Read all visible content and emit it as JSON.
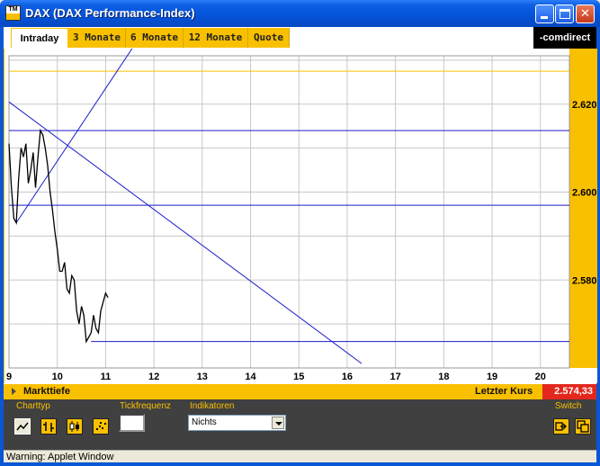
{
  "window": {
    "title": "DAX (DAX Performance-Index)",
    "icon_label": "TM",
    "minimize_glyph": "",
    "close_glyph": "✕"
  },
  "tabs": [
    {
      "label": "Intraday",
      "active": true
    },
    {
      "label": "3 Monate",
      "active": false
    },
    {
      "label": "6 Monate",
      "active": false
    },
    {
      "label": "12 Monate",
      "active": false
    },
    {
      "label": "Quote",
      "active": false
    }
  ],
  "brand": "-comdirect",
  "chart_data": {
    "type": "line",
    "x_ticks": [
      "9",
      "10",
      "11",
      "12",
      "13",
      "14",
      "15",
      "16",
      "17",
      "18",
      "19",
      "20"
    ],
    "y_ticks": [
      "2.620",
      "2.600",
      "2.580"
    ],
    "y_tick_values": [
      2620,
      2600,
      2580
    ],
    "x_range": [
      9,
      20.6
    ],
    "y_range": [
      2560,
      2631
    ],
    "grid": true,
    "series": [
      {
        "color": "#000000",
        "x": [
          9.0,
          9.05,
          9.1,
          9.15,
          9.2,
          9.25,
          9.3,
          9.35,
          9.4,
          9.45,
          9.5,
          9.55,
          9.6,
          9.65,
          9.7,
          9.75,
          9.8,
          9.85,
          9.9,
          9.95,
          10.0,
          10.05,
          10.1,
          10.15,
          10.2,
          10.25,
          10.3,
          10.35,
          10.4,
          10.45,
          10.5,
          10.55,
          10.6,
          10.65,
          10.7,
          10.75,
          10.8,
          10.85,
          10.9,
          10.95,
          11.0,
          11.05
        ],
        "y": [
          2611,
          2601,
          2594,
          2593,
          2603,
          2610,
          2608,
          2611,
          2602,
          2605,
          2609,
          2601,
          2608,
          2614,
          2613,
          2610,
          2606,
          2600,
          2596,
          2591,
          2587,
          2582,
          2582,
          2584,
          2578,
          2577,
          2581,
          2580,
          2573,
          2570,
          2574,
          2572,
          2566,
          2567,
          2568,
          2572,
          2569,
          2568,
          2573,
          2575,
          2577,
          2576
        ]
      }
    ],
    "reference_lines": [
      {
        "kind": "horizontal",
        "y": 2627.5,
        "color": "#f9c000"
      },
      {
        "kind": "horizontal",
        "y": 2614,
        "color": "#1c1ccc"
      },
      {
        "kind": "horizontal",
        "y": 2597,
        "color": "#1c1ccc"
      },
      {
        "kind": "horizontal",
        "y": 2566,
        "color": "#1c1ccc",
        "x_start": 10.7
      },
      {
        "kind": "trend",
        "from": [
          9.0,
          2620.5
        ],
        "to": [
          16.3,
          2561
        ],
        "color": "#1c1ccc"
      },
      {
        "kind": "trend",
        "from": [
          9.15,
          2593
        ],
        "to": [
          11.6,
          2633.5
        ],
        "color": "#1c1ccc"
      }
    ]
  },
  "infobar": {
    "left_label": "Markttiefe",
    "last_price_label": "Letzter Kurs",
    "last_price_value": "2.574,33"
  },
  "controls": {
    "charttyp_label": "Charttyp",
    "tickfrequenz_label": "Tickfrequenz",
    "indikatoren_label": "Indikatoren",
    "indikatoren_value": "Nichts",
    "switch_label": "Switch"
  },
  "status_text": "Warning: Applet Window",
  "colors": {
    "accent": "#f9c000",
    "title_blue": "#0452d8",
    "price_red": "#e3271c",
    "panel_dark": "#404040"
  }
}
